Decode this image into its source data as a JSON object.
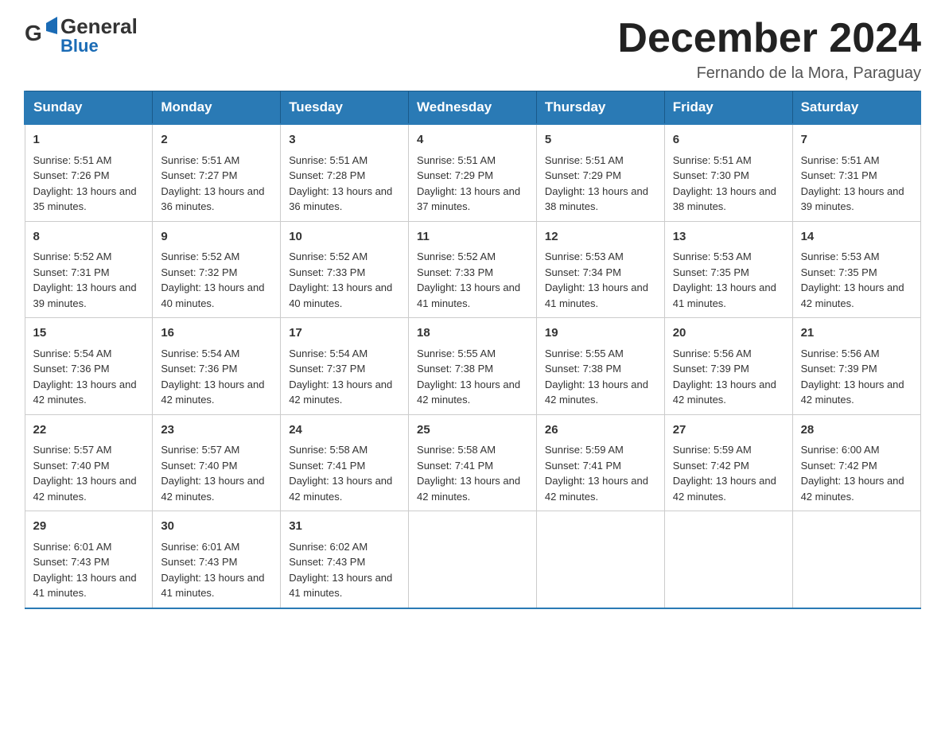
{
  "header": {
    "logo_general": "General",
    "logo_blue": "Blue",
    "month_title": "December 2024",
    "location": "Fernando de la Mora, Paraguay"
  },
  "days_of_week": [
    "Sunday",
    "Monday",
    "Tuesday",
    "Wednesday",
    "Thursday",
    "Friday",
    "Saturday"
  ],
  "weeks": [
    [
      {
        "day": "1",
        "sunrise": "5:51 AM",
        "sunset": "7:26 PM",
        "daylight": "13 hours and 35 minutes."
      },
      {
        "day": "2",
        "sunrise": "5:51 AM",
        "sunset": "7:27 PM",
        "daylight": "13 hours and 36 minutes."
      },
      {
        "day": "3",
        "sunrise": "5:51 AM",
        "sunset": "7:28 PM",
        "daylight": "13 hours and 36 minutes."
      },
      {
        "day": "4",
        "sunrise": "5:51 AM",
        "sunset": "7:29 PM",
        "daylight": "13 hours and 37 minutes."
      },
      {
        "day": "5",
        "sunrise": "5:51 AM",
        "sunset": "7:29 PM",
        "daylight": "13 hours and 38 minutes."
      },
      {
        "day": "6",
        "sunrise": "5:51 AM",
        "sunset": "7:30 PM",
        "daylight": "13 hours and 38 minutes."
      },
      {
        "day": "7",
        "sunrise": "5:51 AM",
        "sunset": "7:31 PM",
        "daylight": "13 hours and 39 minutes."
      }
    ],
    [
      {
        "day": "8",
        "sunrise": "5:52 AM",
        "sunset": "7:31 PM",
        "daylight": "13 hours and 39 minutes."
      },
      {
        "day": "9",
        "sunrise": "5:52 AM",
        "sunset": "7:32 PM",
        "daylight": "13 hours and 40 minutes."
      },
      {
        "day": "10",
        "sunrise": "5:52 AM",
        "sunset": "7:33 PM",
        "daylight": "13 hours and 40 minutes."
      },
      {
        "day": "11",
        "sunrise": "5:52 AM",
        "sunset": "7:33 PM",
        "daylight": "13 hours and 41 minutes."
      },
      {
        "day": "12",
        "sunrise": "5:53 AM",
        "sunset": "7:34 PM",
        "daylight": "13 hours and 41 minutes."
      },
      {
        "day": "13",
        "sunrise": "5:53 AM",
        "sunset": "7:35 PM",
        "daylight": "13 hours and 41 minutes."
      },
      {
        "day": "14",
        "sunrise": "5:53 AM",
        "sunset": "7:35 PM",
        "daylight": "13 hours and 42 minutes."
      }
    ],
    [
      {
        "day": "15",
        "sunrise": "5:54 AM",
        "sunset": "7:36 PM",
        "daylight": "13 hours and 42 minutes."
      },
      {
        "day": "16",
        "sunrise": "5:54 AM",
        "sunset": "7:36 PM",
        "daylight": "13 hours and 42 minutes."
      },
      {
        "day": "17",
        "sunrise": "5:54 AM",
        "sunset": "7:37 PM",
        "daylight": "13 hours and 42 minutes."
      },
      {
        "day": "18",
        "sunrise": "5:55 AM",
        "sunset": "7:38 PM",
        "daylight": "13 hours and 42 minutes."
      },
      {
        "day": "19",
        "sunrise": "5:55 AM",
        "sunset": "7:38 PM",
        "daylight": "13 hours and 42 minutes."
      },
      {
        "day": "20",
        "sunrise": "5:56 AM",
        "sunset": "7:39 PM",
        "daylight": "13 hours and 42 minutes."
      },
      {
        "day": "21",
        "sunrise": "5:56 AM",
        "sunset": "7:39 PM",
        "daylight": "13 hours and 42 minutes."
      }
    ],
    [
      {
        "day": "22",
        "sunrise": "5:57 AM",
        "sunset": "7:40 PM",
        "daylight": "13 hours and 42 minutes."
      },
      {
        "day": "23",
        "sunrise": "5:57 AM",
        "sunset": "7:40 PM",
        "daylight": "13 hours and 42 minutes."
      },
      {
        "day": "24",
        "sunrise": "5:58 AM",
        "sunset": "7:41 PM",
        "daylight": "13 hours and 42 minutes."
      },
      {
        "day": "25",
        "sunrise": "5:58 AM",
        "sunset": "7:41 PM",
        "daylight": "13 hours and 42 minutes."
      },
      {
        "day": "26",
        "sunrise": "5:59 AM",
        "sunset": "7:41 PM",
        "daylight": "13 hours and 42 minutes."
      },
      {
        "day": "27",
        "sunrise": "5:59 AM",
        "sunset": "7:42 PM",
        "daylight": "13 hours and 42 minutes."
      },
      {
        "day": "28",
        "sunrise": "6:00 AM",
        "sunset": "7:42 PM",
        "daylight": "13 hours and 42 minutes."
      }
    ],
    [
      {
        "day": "29",
        "sunrise": "6:01 AM",
        "sunset": "7:43 PM",
        "daylight": "13 hours and 41 minutes."
      },
      {
        "day": "30",
        "sunrise": "6:01 AM",
        "sunset": "7:43 PM",
        "daylight": "13 hours and 41 minutes."
      },
      {
        "day": "31",
        "sunrise": "6:02 AM",
        "sunset": "7:43 PM",
        "daylight": "13 hours and 41 minutes."
      },
      null,
      null,
      null,
      null
    ]
  ]
}
